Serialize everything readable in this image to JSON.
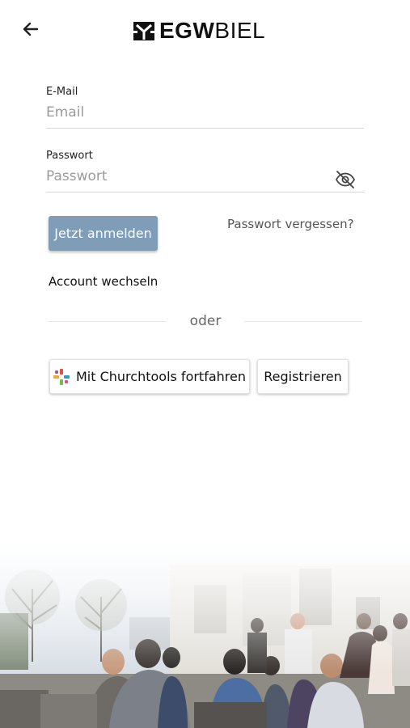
{
  "header": {
    "logo_bold": "EGW",
    "logo_light": "BIEL"
  },
  "form": {
    "email": {
      "label": "E-Mail",
      "placeholder": "Email",
      "value": ""
    },
    "password": {
      "label": "Passwort",
      "placeholder": "Passwort",
      "value": ""
    }
  },
  "actions": {
    "login_label": "Jetzt anmelden",
    "forgot_label": "Passwort vergessen?",
    "switch_account_label": "Account wechseln",
    "divider_label": "oder",
    "churchtools_label": "Mit Churchtools fortfahren",
    "register_label": "Registrieren"
  },
  "colors": {
    "primary_button": "#7f9db7",
    "background": "#ffffff"
  },
  "icons": [
    "back-arrow-icon",
    "egw-logo-icon",
    "eye-off-icon",
    "churchtools-icon"
  ]
}
